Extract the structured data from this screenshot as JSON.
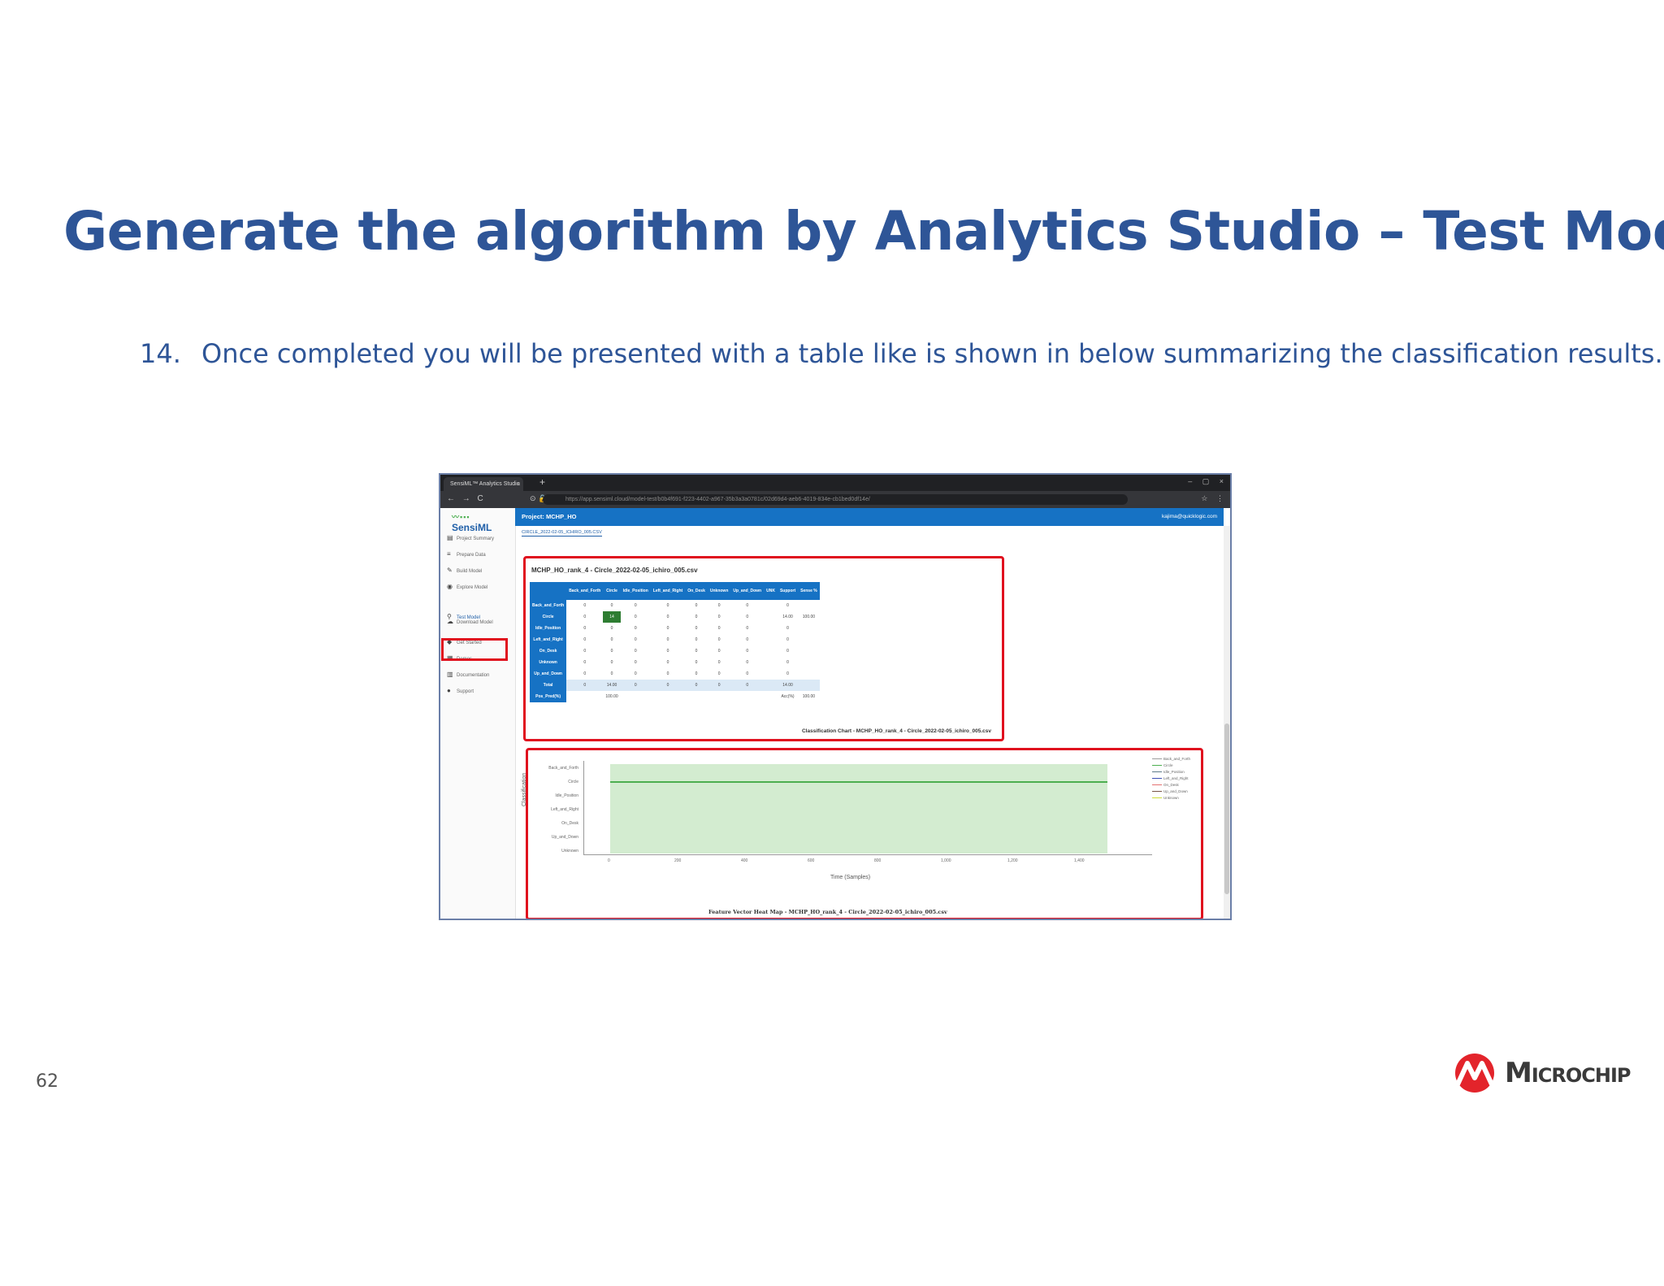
{
  "slide": {
    "title": "Generate the algorithm by Analytics Studio – Test Model",
    "bullet_number": "14.",
    "bullet_text": "Once completed you will be presented with a table like is shown in below summarizing the classification results.",
    "page_number": "62",
    "logo_text": "Microchip"
  },
  "browser": {
    "tab_title": "SensiML™ Analytics Studio",
    "tab_close": "×",
    "new_tab": "+",
    "url": "https://app.sensiml.cloud/model-test/b0b4f691-f223-4402-a967-35b3a3a0781c/02d69d4-aeb6-4019-834e-cb1bed0df14e/",
    "nav": "← → C",
    "url_icons": "⊙ 🔒",
    "bar_right": "☆ ⋮",
    "window_controls": "– ▢ ×"
  },
  "app": {
    "brand": "SensiML",
    "brand_mark": "〰▪▪▪",
    "project": "Project: MCHP_HO",
    "user": "kajima@quicklogic.com",
    "subtab": "CIRCLE_2022-02-05_ICHIRO_005.CSV",
    "sidebar": [
      {
        "icon": "▤",
        "label": "Project Summary"
      },
      {
        "icon": "≡",
        "label": "Prepare Data"
      },
      {
        "icon": "✎",
        "label": "Build Model"
      },
      {
        "icon": "◉",
        "label": "Explore Model"
      },
      {
        "icon": "⚲",
        "label": "Test Model"
      },
      {
        "icon": "☁",
        "label": "Download Model"
      },
      {
        "icon": "◆",
        "label": "Get Started"
      },
      {
        "icon": "▦",
        "label": "Demos"
      },
      {
        "icon": "▥",
        "label": "Documentation"
      },
      {
        "icon": "●",
        "label": "Support"
      }
    ]
  },
  "matrix": {
    "title": "MCHP_HO_rank_4 - Circle_2022-02-05_ichiro_005.csv",
    "columns": [
      "",
      "Back_and_Forth",
      "Circle",
      "Idle_Position",
      "Left_and_Right",
      "On_Desk",
      "Unknown",
      "Up_and_Down",
      "UNK",
      "Support",
      "Sense %"
    ],
    "rows": [
      [
        "Back_and_Forth",
        "0",
        "0",
        "0",
        "0",
        "0",
        "0",
        "0",
        "",
        "0",
        ""
      ],
      [
        "Circle",
        "0",
        "14",
        "0",
        "0",
        "0",
        "0",
        "0",
        "",
        "14.00",
        "100.00"
      ],
      [
        "Idle_Position",
        "0",
        "0",
        "0",
        "0",
        "0",
        "0",
        "0",
        "",
        "0",
        ""
      ],
      [
        "Left_and_Right",
        "0",
        "0",
        "0",
        "0",
        "0",
        "0",
        "0",
        "",
        "0",
        ""
      ],
      [
        "On_Desk",
        "0",
        "0",
        "0",
        "0",
        "0",
        "0",
        "0",
        "",
        "0",
        ""
      ],
      [
        "Unknown",
        "0",
        "0",
        "0",
        "0",
        "0",
        "0",
        "0",
        "",
        "0",
        ""
      ],
      [
        "Up_and_Down",
        "0",
        "0",
        "0",
        "0",
        "0",
        "0",
        "0",
        "",
        "0",
        ""
      ],
      [
        "Total",
        "0",
        "14.00",
        "0",
        "0",
        "0",
        "0",
        "0",
        "",
        "14.00",
        ""
      ],
      [
        "Pos_Pred(%)",
        "",
        "100.00",
        "",
        "",
        "",
        "",
        "",
        "",
        "Acc(%)",
        "100.00"
      ]
    ]
  },
  "classification_chart": {
    "title": "Classification Chart - MCHP_HO_rank_4 - Circle_2022-02-05_ichiro_005.csv",
    "ylabel": "Classification",
    "xlabel": "Time (Samples)",
    "yticks": [
      "Back_and_Forth",
      "Circle",
      "Idle_Position",
      "Left_and_Right",
      "On_Desk",
      "Up_and_Down",
      "Unknown"
    ],
    "xticks": [
      "0",
      "200",
      "400",
      "600",
      "800",
      "1,000",
      "1,200",
      "1,400"
    ],
    "legend": [
      {
        "label": "Back_and_Forth",
        "color": "#9e9e9e"
      },
      {
        "label": "Circle",
        "color": "#4caf50"
      },
      {
        "label": "Idle_Position",
        "color": "#607d8b"
      },
      {
        "label": "Left_and_Right",
        "color": "#3f51b5"
      },
      {
        "label": "On_Desk",
        "color": "#e57373"
      },
      {
        "label": "Up_and_Down",
        "color": "#795548"
      },
      {
        "label": "Unknown",
        "color": "#cddc39"
      }
    ]
  },
  "heatmap_title": "Feature Vector Heat Map - MCHP_HO_rank_4 - Circle_2022-02-05_ichiro_005.csv"
}
